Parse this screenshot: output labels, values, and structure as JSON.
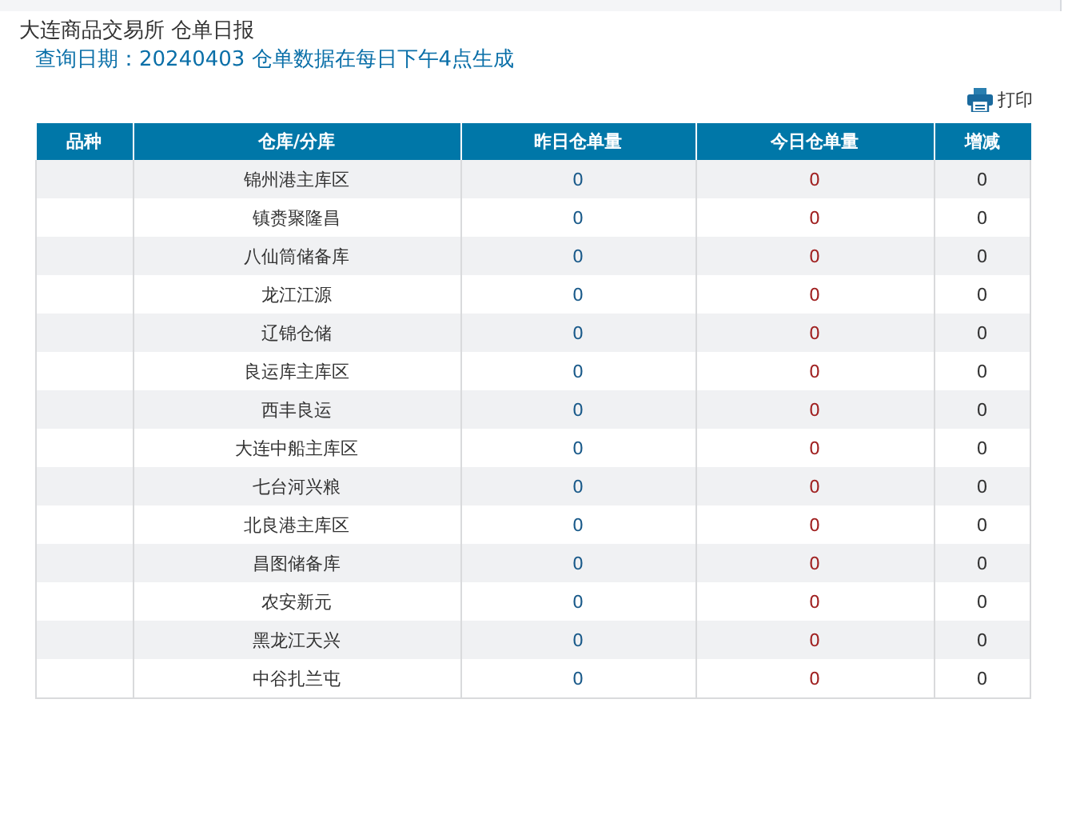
{
  "title": "大连商品交易所 仓单日报",
  "subtitle": "查询日期：20240403 仓单数据在每日下午4点生成",
  "print_button": "打印",
  "table": {
    "columns": [
      "品种",
      "仓库/分库",
      "昨日仓单量",
      "今日仓单量",
      "增减"
    ],
    "rows": [
      {
        "variety": "",
        "warehouse": "锦州港主库区",
        "yesterday": "0",
        "today": "0",
        "change": "0"
      },
      {
        "variety": "",
        "warehouse": "镇赉聚隆昌",
        "yesterday": "0",
        "today": "0",
        "change": "0"
      },
      {
        "variety": "",
        "warehouse": "八仙筒储备库",
        "yesterday": "0",
        "today": "0",
        "change": "0"
      },
      {
        "variety": "",
        "warehouse": "龙江江源",
        "yesterday": "0",
        "today": "0",
        "change": "0"
      },
      {
        "variety": "",
        "warehouse": "辽锦仓储",
        "yesterday": "0",
        "today": "0",
        "change": "0"
      },
      {
        "variety": "",
        "warehouse": "良运库主库区",
        "yesterday": "0",
        "today": "0",
        "change": "0"
      },
      {
        "variety": "",
        "warehouse": "西丰良运",
        "yesterday": "0",
        "today": "0",
        "change": "0"
      },
      {
        "variety": "",
        "warehouse": "大连中船主库区",
        "yesterday": "0",
        "today": "0",
        "change": "0"
      },
      {
        "variety": "",
        "warehouse": "七台河兴粮",
        "yesterday": "0",
        "today": "0",
        "change": "0"
      },
      {
        "variety": "",
        "warehouse": "北良港主库区",
        "yesterday": "0",
        "today": "0",
        "change": "0"
      },
      {
        "variety": "",
        "warehouse": "昌图储备库",
        "yesterday": "0",
        "today": "0",
        "change": "0"
      },
      {
        "variety": "",
        "warehouse": "农安新元",
        "yesterday": "0",
        "today": "0",
        "change": "0"
      },
      {
        "variety": "",
        "warehouse": "黑龙江天兴",
        "yesterday": "0",
        "today": "0",
        "change": "0"
      },
      {
        "variety": "",
        "warehouse": "中谷扎兰屯",
        "yesterday": "0",
        "today": "0",
        "change": "0"
      }
    ]
  }
}
